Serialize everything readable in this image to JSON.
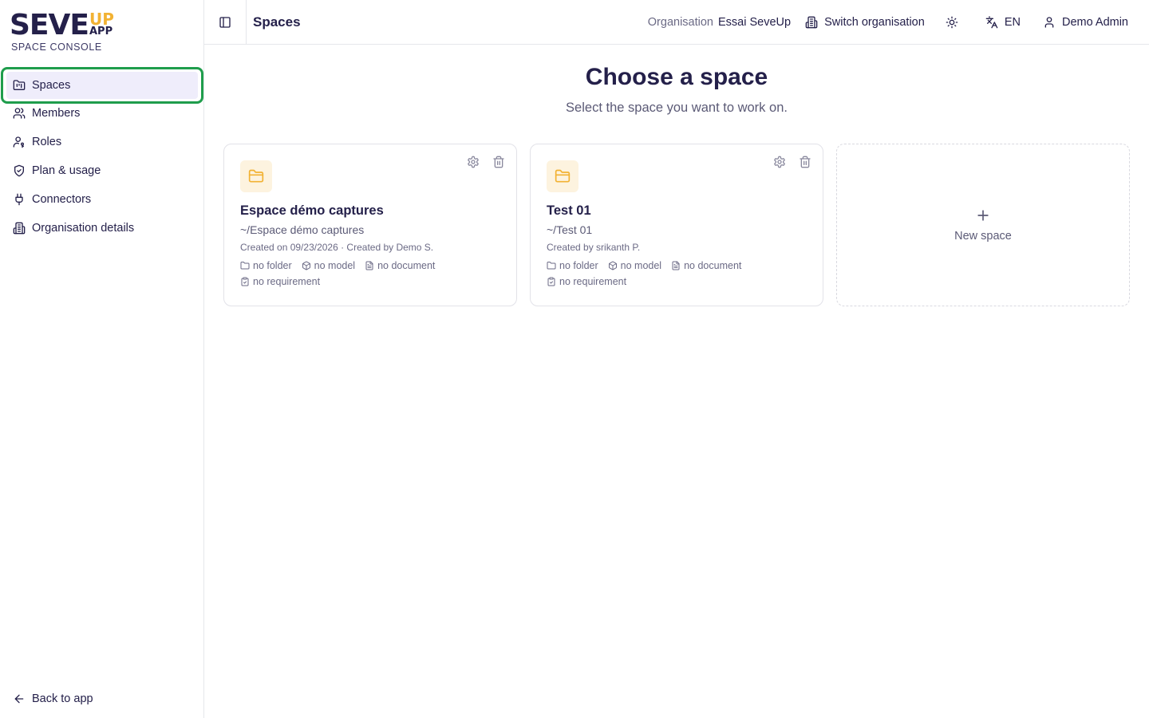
{
  "brand": {
    "logo_main": "SEVE",
    "logo_up": "UP",
    "logo_app": "APP",
    "subtitle": "SPACE CONSOLE",
    "colors": {
      "dark": "#24204a",
      "accent": "#f2b233",
      "highlight": "#1f9d4c"
    }
  },
  "sidebar": {
    "items": [
      {
        "label": "Spaces",
        "icon": "folder-kanban-icon",
        "active": true
      },
      {
        "label": "Members",
        "icon": "users-icon"
      },
      {
        "label": "Roles",
        "icon": "user-key-icon"
      },
      {
        "label": "Plan & usage",
        "icon": "shield-check-icon"
      },
      {
        "label": "Connectors",
        "icon": "plug-icon"
      },
      {
        "label": "Organisation details",
        "icon": "building-icon"
      }
    ],
    "back_label": "Back to app"
  },
  "topbar": {
    "title": "Spaces",
    "org_label": "Organisation",
    "org_name": "Essai SeveUp",
    "switch_label": "Switch organisation",
    "language": "EN",
    "user": "Demo Admin"
  },
  "main": {
    "heading": "Choose a space",
    "subheading": "Select the space you want to work on.",
    "spaces": [
      {
        "title": "Espace démo captures",
        "path": "~/Espace démo captures",
        "meta": "Created on 09/23/2026 · Created by Demo S.",
        "stats": {
          "folder": "no folder",
          "model": "no model",
          "document": "no document",
          "requirement": "no requirement"
        }
      },
      {
        "title": "Test 01",
        "path": "~/Test 01",
        "meta": "Created by srikanth P.",
        "stats": {
          "folder": "no folder",
          "model": "no model",
          "document": "no document",
          "requirement": "no requirement"
        }
      }
    ],
    "new_space_label": "New space"
  }
}
